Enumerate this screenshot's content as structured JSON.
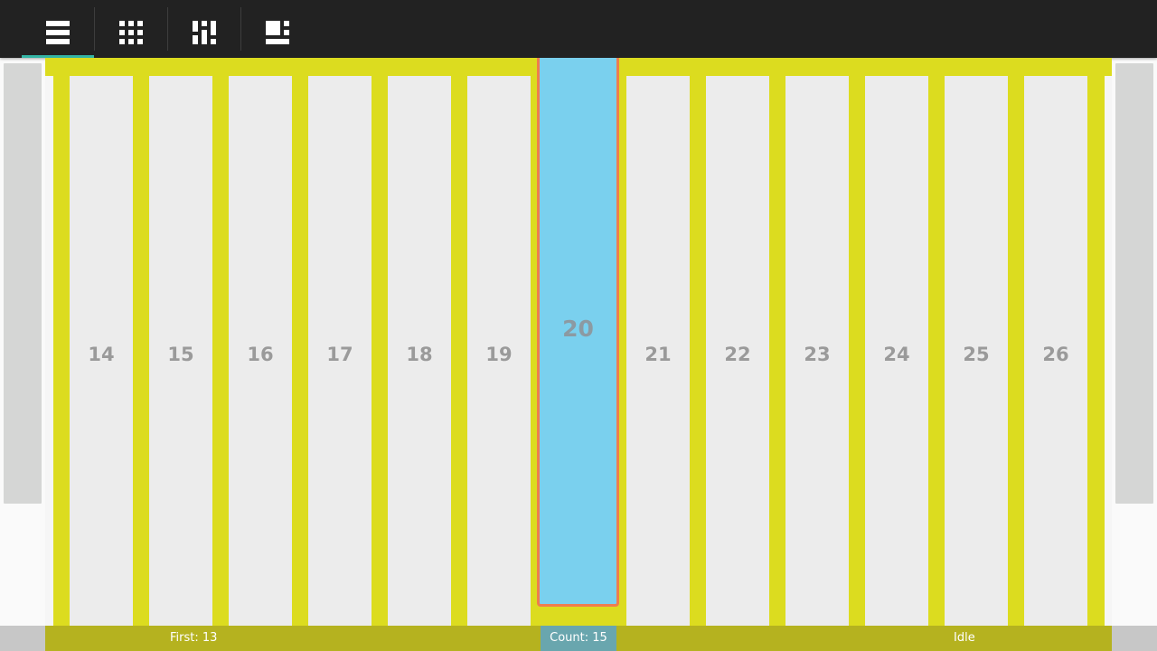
{
  "toolbar": {
    "buttons": [
      {
        "icon": "list-view-icon",
        "active": true
      },
      {
        "icon": "grid-view-icon",
        "active": false
      },
      {
        "icon": "staggered-grid-icon",
        "active": false
      },
      {
        "icon": "spannable-grid-icon",
        "active": false
      }
    ],
    "accent_color": "#33b5a5"
  },
  "items": [
    "14",
    "15",
    "16",
    "17",
    "18",
    "19",
    "20",
    "21",
    "22",
    "23",
    "24",
    "25",
    "26"
  ],
  "selected_item": "20",
  "colors": {
    "strip": "#dcdc1f",
    "item": "#ececec",
    "selected_fill": "#7ad0ee",
    "selected_border": "#ee7d4e",
    "status_bar": "#b5b21f"
  },
  "status": {
    "first": "First: 13",
    "count": "Count: 15",
    "state": "Idle"
  }
}
